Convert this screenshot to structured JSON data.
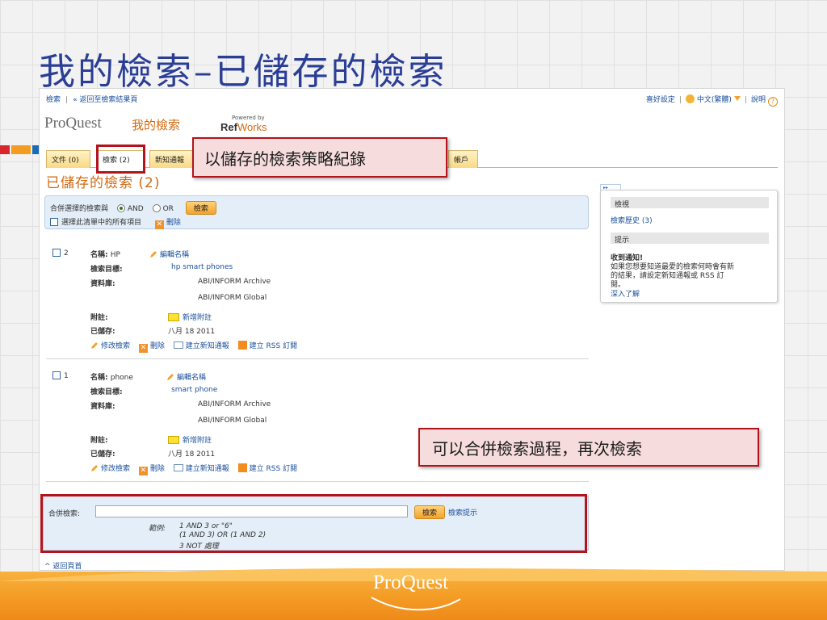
{
  "slide": {
    "title": "我的檢索–已儲存的檢索",
    "footer_logo": "ProQuest",
    "colors": {
      "title": "#2b3e96",
      "band": "#f39b25",
      "accent_red": "#b3141c",
      "brand_orange": "#d06a12"
    }
  },
  "top_nav": {
    "search_link": "檢索",
    "sep": "|",
    "back_link": "« 返回至檢索結果頁"
  },
  "util_nav": {
    "preferences": "喜好設定",
    "language": "中文(繁體)",
    "help": "說明",
    "help_icon_glyph": "?"
  },
  "brand": {
    "logo": "ProQuest",
    "title": "我的檢索",
    "powered_by": "Powered by",
    "ref": "Ref",
    "works": "Works"
  },
  "tabs": {
    "docs": "文件 (0)",
    "searches": "檢索 (2)",
    "alerts_visible": "新知通報",
    "account_visible": "帳戶"
  },
  "page_heading": "已儲存的檢索 (2)",
  "combine": {
    "prefix": "合併選擇的檢索與",
    "and": "AND",
    "or": "OR",
    "button": "檢索",
    "select_all": "選擇此清單中的所有項目",
    "delete": "刪除"
  },
  "records": [
    {
      "num": "2",
      "name_label": "名稱:",
      "name": "HP",
      "edit_name": "編輯名稱",
      "target_label": "檢索目標:",
      "target": "hp smart phones",
      "db_label": "資料庫:",
      "db1": "ABI/INFORM Archive",
      "db2": "ABI/INFORM Global",
      "note_label": "附註:",
      "add_note": "新增附註",
      "saved_label": "已儲存:",
      "saved": "八月 18 2011",
      "action_edit": "修改檢索",
      "action_delete": "刪除",
      "action_alert": "建立新知通報",
      "action_rss": "建立 RSS 訂閱"
    },
    {
      "num": "1",
      "name_label": "名稱:",
      "name": "phone",
      "edit_name": "編輯名稱",
      "target_label": "檢索目標:",
      "target": "smart phone",
      "db_label": "資料庫:",
      "db1": "ABI/INFORM Archive",
      "db2": "ABI/INFORM Global",
      "note_label": "附註:",
      "add_note": "新增附註",
      "saved_label": "已儲存:",
      "saved": "八月 18 2011",
      "action_edit": "修改檢索",
      "action_delete": "刪除",
      "action_alert": "建立新知通報",
      "action_rss": "建立 RSS 訂閱"
    }
  ],
  "combined_search": {
    "label": "合併檢索:",
    "input_value": "",
    "button": "檢索",
    "tips": "檢索提示",
    "example_label": "範例:",
    "examples": [
      "1 AND 3 or \"6\"",
      "(1 AND 3) OR (1 AND 2)",
      "3 NOT 處理"
    ]
  },
  "back_to_top": "^ 返回頁首",
  "sidebar": {
    "tag": "▸▸",
    "view_head": "檢視",
    "history": "檢索歷史 (3)",
    "tip_head": "提示",
    "tip_title": "收到通知!",
    "tip_line1": "如果您想要知道最愛的檢索何時會有新",
    "tip_line2": "的結果，請設定新知通報或 RSS 訂",
    "tip_line3": "閱。",
    "learn_more": "深入了解"
  },
  "callouts": {
    "tab_note": "以儲存的檢索策略紀錄",
    "combine_note": "可以合併檢索過程，再次檢索"
  }
}
